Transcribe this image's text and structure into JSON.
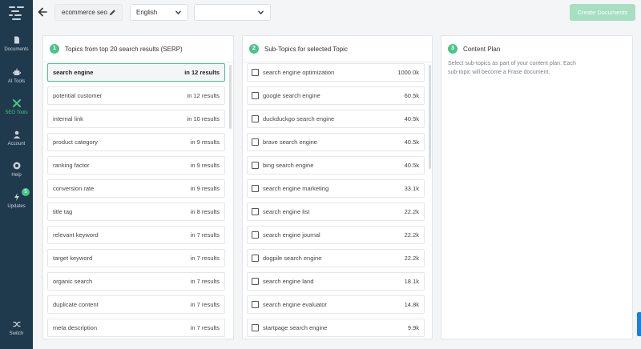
{
  "sidebar": {
    "items": [
      {
        "label": "Documents",
        "icon": "document-icon"
      },
      {
        "label": "AI Tools",
        "icon": "robot-icon"
      },
      {
        "label": "SEO Tools",
        "icon": "tools-icon"
      },
      {
        "label": "Account",
        "icon": "user-icon"
      },
      {
        "label": "Help",
        "icon": "help-icon"
      },
      {
        "label": "Updates",
        "icon": "lightning-icon",
        "badge": "5"
      },
      {
        "label": "Switch",
        "icon": "shuffle-icon"
      }
    ]
  },
  "header": {
    "project_name": "ecommerce seo",
    "language": "English",
    "second_select": "",
    "create_button": "Create Documents"
  },
  "topics_panel": {
    "step": "1",
    "title": "Topics from top 20 search results (SERP)",
    "rows": [
      {
        "label": "search engine",
        "value": "in 12 results"
      },
      {
        "label": "potential customer",
        "value": "in 12 results"
      },
      {
        "label": "internal link",
        "value": "in 10 results"
      },
      {
        "label": "product category",
        "value": "in 9 results"
      },
      {
        "label": "ranking factor",
        "value": "in 9 results"
      },
      {
        "label": "conversion rate",
        "value": "in 9 results"
      },
      {
        "label": "title tag",
        "value": "in 8 results"
      },
      {
        "label": "relevant keyword",
        "value": "in 7 results"
      },
      {
        "label": "target keyword",
        "value": "in 7 results"
      },
      {
        "label": "organic search",
        "value": "in 7 results"
      },
      {
        "label": "duplicate content",
        "value": "in 7 results"
      },
      {
        "label": "meta description",
        "value": "in 7 results"
      }
    ]
  },
  "subtopics_panel": {
    "step": "2",
    "title": "Sub-Topics for selected Topic",
    "rows": [
      {
        "label": "search engine optimization",
        "value": "1000.0k"
      },
      {
        "label": "google search engine",
        "value": "60.5k"
      },
      {
        "label": "duckduckgo search engine",
        "value": "40.5k"
      },
      {
        "label": "brave search engine",
        "value": "40.5k"
      },
      {
        "label": "bing search engine",
        "value": "40.5k"
      },
      {
        "label": "search engine marketing",
        "value": "33.1k"
      },
      {
        "label": "search engine list",
        "value": "22.2k"
      },
      {
        "label": "search engine journal",
        "value": "22.2k"
      },
      {
        "label": "dogpile search engine",
        "value": "22.2k"
      },
      {
        "label": "search engine land",
        "value": "18.1k"
      },
      {
        "label": "search engine evaluator",
        "value": "14.8k"
      },
      {
        "label": "startpage search engine",
        "value": "9.9k"
      }
    ]
  },
  "plan_panel": {
    "step": "3",
    "title": "Content Plan",
    "description": "Select sub-topics as part of your content plan. Each sub-topic will become a Frase document."
  },
  "colors": {
    "sidebar": "#1f3a4d",
    "accent": "#4cc38a",
    "button_disabled": "#a6dfc1"
  }
}
